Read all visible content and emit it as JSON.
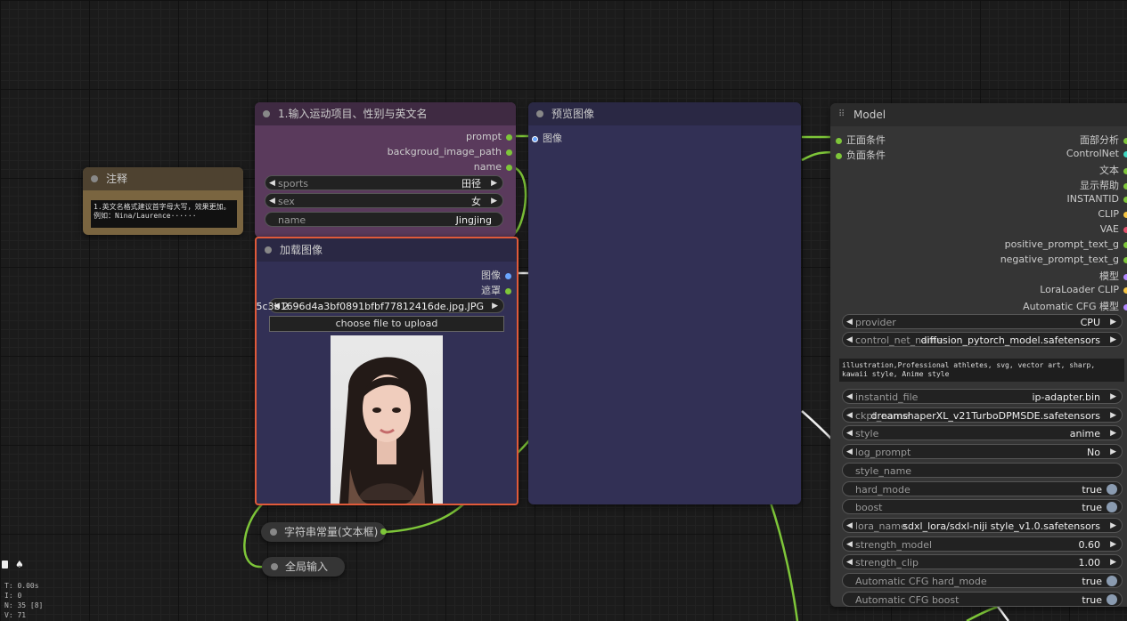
{
  "colors": {
    "link": "#7ec639",
    "node_prompt": "#5a3a5c",
    "node_body": "#323055",
    "node_title": "#2a2844",
    "note": "#7a6540",
    "selected": "#e05a3a"
  },
  "note_node": {
    "title": "注释",
    "text": "1.英文名格式建议首字母大写，效果更加。例如：Nina/Laurence······"
  },
  "prompt_node": {
    "title": "1.输入运动项目、性别与英文名",
    "outputs": [
      "prompt",
      "backgroud_image_path",
      "name"
    ],
    "widgets": [
      {
        "label": "sports",
        "value": "田径"
      },
      {
        "label": "sex",
        "value": "女"
      },
      {
        "label": "name",
        "value": "Jingjing"
      }
    ]
  },
  "load_image_node": {
    "title": "加载图像",
    "outputs": [
      "图像",
      "遮罩"
    ],
    "file": "a5c3b1696d4a3bf0891bfbf77812416de.jpg.JPG",
    "file_prefix": "2",
    "upload_label": "choose file to upload"
  },
  "preview_node": {
    "title": "预览图像",
    "input": "图像"
  },
  "model_node": {
    "title": "Model",
    "inputs": [
      "正面条件",
      "负面条件"
    ],
    "outputs": [
      "面部分析",
      "ControlNet",
      "文本",
      "显示帮助",
      "INSTANTID",
      "CLIP",
      "VAE",
      "positive_prompt_text_g",
      "negative_prompt_text_g",
      "模型",
      "LoraLoader CLIP",
      "Automatic CFG 模型"
    ],
    "widgets_top": [
      {
        "label": "provider",
        "value": "CPU"
      },
      {
        "label": "control_net_name",
        "value": "diffusion_pytorch_model.safetensors"
      }
    ],
    "style_text": "illustration,Professional athletes, svg, vector art, sharp, kawaii style, Anime style",
    "widgets_bottom": [
      {
        "label": "instantid_file",
        "value": "ip-adapter.bin",
        "kind": "combo"
      },
      {
        "label": "ckpt_name",
        "value": "dreamshaperXL_v21TurboDPMSDE.safetensors",
        "kind": "combo"
      },
      {
        "label": "style",
        "value": "anime",
        "kind": "combo"
      },
      {
        "label": "log_prompt",
        "value": "No",
        "kind": "combo"
      },
      {
        "label": "style_name",
        "value": "",
        "kind": "text"
      },
      {
        "label": "hard_mode",
        "value": "true",
        "kind": "toggle"
      },
      {
        "label": "boost",
        "value": "true",
        "kind": "toggle"
      },
      {
        "label": "lora_name",
        "value": "sdxl_lora/sdxl-niji style_v1.0.safetensors",
        "kind": "combo"
      },
      {
        "label": "strength_model",
        "value": "0.60",
        "kind": "combo"
      },
      {
        "label": "strength_clip",
        "value": "1.00",
        "kind": "combo"
      },
      {
        "label": "Automatic CFG hard_mode",
        "value": "true",
        "kind": "toggle"
      },
      {
        "label": "Automatic CFG boost",
        "value": "true",
        "kind": "toggle"
      }
    ]
  },
  "string_node": {
    "title": "字符串常量(文本框)"
  },
  "global_input_node": {
    "title": "全局输入"
  },
  "stats": [
    "T: 0.00s",
    "I: 0",
    "N: 35 [8]",
    "V: 71"
  ]
}
